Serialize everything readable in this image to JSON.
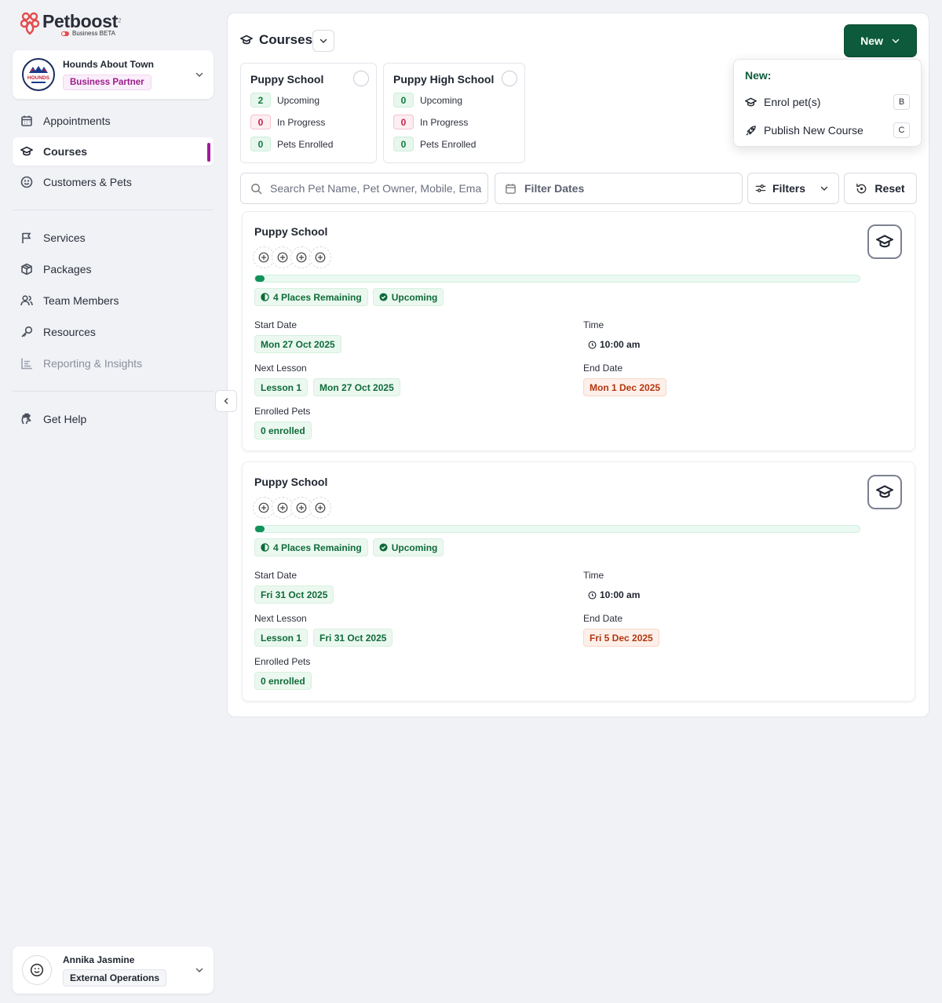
{
  "brand": {
    "name": "Petboost",
    "superscript": "2",
    "subtitle": "Business BETA"
  },
  "business": {
    "name": "Hounds About Town",
    "badge": "Business Partner",
    "logo_text": "HOUNDS"
  },
  "sidebar": {
    "items": [
      {
        "label": "Appointments",
        "icon": "calendar-icon"
      },
      {
        "label": "Courses",
        "icon": "graduation-cap-icon",
        "active": true
      },
      {
        "label": "Customers & Pets",
        "icon": "smiley-icon"
      },
      {
        "label": "Services",
        "icon": "flag-icon"
      },
      {
        "label": "Packages",
        "icon": "package-icon"
      },
      {
        "label": "Team Members",
        "icon": "team-icon"
      },
      {
        "label": "Resources",
        "icon": "key-icon"
      },
      {
        "label": "Reporting & Insights",
        "icon": "chart-icon",
        "disabled": true
      },
      {
        "label": "Get Help",
        "icon": "help-hand-icon"
      }
    ]
  },
  "user": {
    "name": "Annika Jasmine",
    "role": "External Operations"
  },
  "header": {
    "title": "Courses",
    "new_label": "New"
  },
  "stats": [
    {
      "title": "Puppy School",
      "upcoming": "2",
      "in_progress": "0",
      "enrolled": "0"
    },
    {
      "title": "Puppy High School",
      "upcoming": "0",
      "in_progress": "0",
      "enrolled": "0"
    }
  ],
  "stat_labels": {
    "upcoming": "Upcoming",
    "in_progress": "In Progress",
    "enrolled": "Pets Enrolled"
  },
  "toolbar": {
    "search_placeholder": "Search Pet Name, Pet Owner, Mobile, Email, Course",
    "filter_dates": "Filter Dates",
    "filters": "Filters",
    "reset": "Reset"
  },
  "labels": {
    "start_date": "Start Date",
    "time": "Time",
    "next_lesson": "Next Lesson",
    "end_date": "End Date",
    "enrolled_pets": "Enrolled Pets"
  },
  "courses": [
    {
      "title": "Puppy School",
      "progress": 0.015,
      "places": "4 Places Remaining",
      "status": "Upcoming",
      "start_date": "Mon 27 Oct 2025",
      "time": "10:00 am",
      "next_lesson": "Lesson 1",
      "next_lesson_date": "Mon 27 Oct 2025",
      "end_date": "Mon 1 Dec 2025",
      "enrolled": "0 enrolled"
    },
    {
      "title": "Puppy School",
      "progress": 0.015,
      "places": "4 Places Remaining",
      "status": "Upcoming",
      "start_date": "Fri 31 Oct 2025",
      "time": "10:00 am",
      "next_lesson": "Lesson 1",
      "next_lesson_date": "Fri 31 Oct 2025",
      "end_date": "Fri 5 Dec 2025",
      "enrolled": "0 enrolled"
    }
  ],
  "new_menu": {
    "heading": "New:",
    "items": [
      {
        "label": "Enrol pet(s)",
        "shortcut": "B",
        "icon": "graduation-cap-icon"
      },
      {
        "label": "Publish New Course",
        "shortcut": "C",
        "icon": "rocket-icon"
      }
    ]
  },
  "colors": {
    "brand_green": "#0d5b3c",
    "accent_purple": "#a3199a",
    "logo_red": "#e34b4b"
  }
}
